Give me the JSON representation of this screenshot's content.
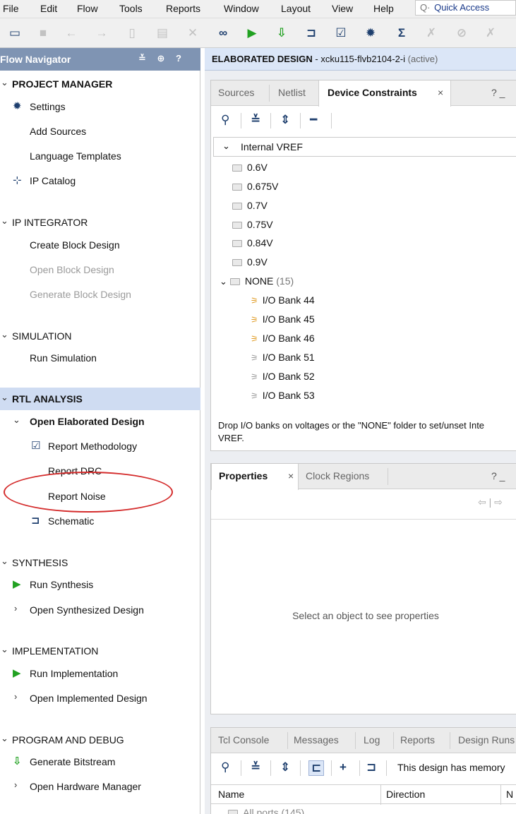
{
  "menu": [
    "File",
    "Edit",
    "Flow",
    "Tools",
    "Reports",
    "Window",
    "Layout",
    "View",
    "Help"
  ],
  "quick_access": {
    "icon": "Q·",
    "label": "Quick Access"
  },
  "flow_navigator": {
    "title": "Flow Navigator",
    "header_icons": "≚ ⊕ ? _",
    "sections": {
      "project_manager": {
        "label": "PROJECT MANAGER",
        "settings": "Settings",
        "add_sources": "Add Sources",
        "language_templates": "Language Templates",
        "ip_catalog": "IP Catalog"
      },
      "ip_integrator": {
        "label": "IP INTEGRATOR",
        "create_block": "Create Block Design",
        "open_block": "Open Block Design",
        "generate_block": "Generate Block Design"
      },
      "simulation": {
        "label": "SIMULATION",
        "run_sim": "Run Simulation"
      },
      "rtl_analysis": {
        "label": "RTL ANALYSIS",
        "open_elaborated": "Open Elaborated Design",
        "report_methodology": "Report Methodology",
        "report_drc": "Report DRC",
        "report_noise": "Report Noise",
        "schematic": "Schematic"
      },
      "synthesis": {
        "label": "SYNTHESIS",
        "run_synth": "Run Synthesis",
        "open_synth": "Open Synthesized Design"
      },
      "implementation": {
        "label": "IMPLEMENTATION",
        "run_impl": "Run Implementation",
        "open_impl": "Open Implemented Design"
      },
      "program_debug": {
        "label": "PROGRAM AND DEBUG",
        "gen_bitstream": "Generate Bitstream",
        "open_hw": "Open Hardware Manager"
      }
    }
  },
  "design_header": {
    "title": "ELABORATED DESIGN",
    "part": " - xcku115-flvb2104-2-i",
    "state": "(active)"
  },
  "constraints_panel": {
    "tabs": [
      "Sources",
      "Netlist",
      "Device Constraints"
    ],
    "close": "×",
    "controls": "? _",
    "root": "Internal VREF",
    "voltages": [
      "0.6V",
      "0.675V",
      "0.7V",
      "0.75V",
      "0.84V",
      "0.9V"
    ],
    "none_label": "NONE",
    "none_count": "(15)",
    "banks": [
      "I/O Bank 44",
      "I/O Bank 45",
      "I/O Bank 46",
      "I/O Bank 51",
      "I/O Bank 52",
      "I/O Bank 53"
    ],
    "hint_line1": "Drop I/O banks on voltages or the \"NONE\" folder to set/unset Inte",
    "hint_line2": "VREF."
  },
  "properties_panel": {
    "tabs": [
      "Properties",
      "Clock Regions"
    ],
    "close": "×",
    "controls": "? _",
    "nav": "⇦ | ⇨",
    "placeholder": "Select an object to see properties"
  },
  "console_panel": {
    "tabs": [
      "Tcl Console",
      "Messages",
      "Log",
      "Reports",
      "Design Runs"
    ],
    "message": "This design has memory",
    "columns": [
      "Name",
      "Direction",
      "N"
    ],
    "first_row": "All ports",
    "first_row_count": "(145)"
  },
  "colors": {
    "nav_header": "#7f94b3",
    "selection": "#cfdcf2",
    "annotation": "#d42b2b",
    "run_green": "#21a121"
  }
}
